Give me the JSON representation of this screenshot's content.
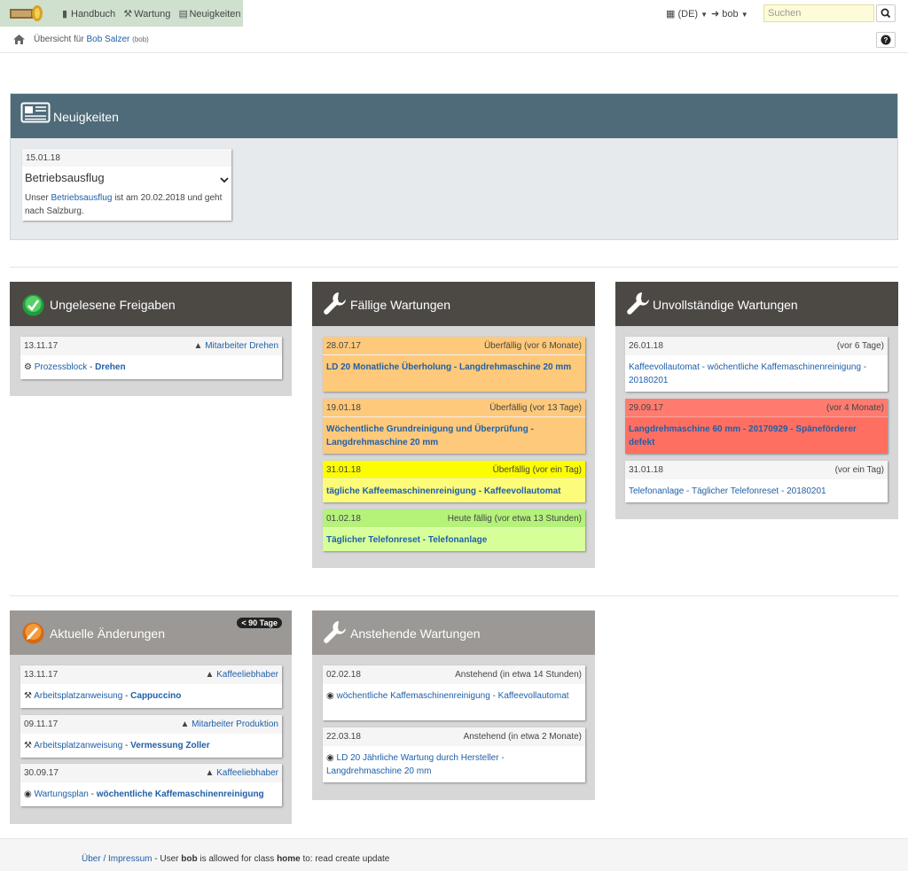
{
  "nav": {
    "handbuch": "Handbuch",
    "wartung": "Wartung",
    "neuigkeiten": "Neuigkeiten",
    "language": "(DE)",
    "user": "bob",
    "search_placeholder": "Suchen"
  },
  "breadcrumb": {
    "prefix": "Übersicht für",
    "user_name": "Bob Salzer",
    "user_login": "(bob)"
  },
  "news": {
    "title": "Neuigkeiten",
    "item": {
      "date": "15.01.18",
      "title": "Betriebsausflug",
      "text_before": "Unser",
      "link": "Betriebsausflug",
      "text_after": "ist am 20.02.2018 und geht nach Salzburg."
    }
  },
  "unread": {
    "title": "Ungelesene Freigaben",
    "items": [
      {
        "date": "13.11.17",
        "role": "Mitarbeiter Drehen",
        "type": "Prozessblock",
        "sep": " - ",
        "name": "Drehen"
      }
    ]
  },
  "due": {
    "title": "Fällige Wartungen",
    "items": [
      {
        "date": "28.07.17",
        "status": "Überfällig (vor 6 Monate)",
        "text": "LD 20 Monatliche Überholung - Langdrehmaschine 20 mm"
      },
      {
        "date": "19.01.18",
        "status": "Überfällig (vor 13 Tage)",
        "text": "Wöchentliche Grundreinigung und Überprüfung - Langdrehmaschine 20 mm"
      },
      {
        "date": "31.01.18",
        "status": "Überfällig (vor ein Tag)",
        "text": "tägliche Kaffeemaschinenreinigung - Kaffeevollautomat"
      },
      {
        "date": "01.02.18",
        "status": "Heute fällig (vor etwa 13 Stunden)",
        "text": "Täglicher Telefonreset - Telefonanlage"
      }
    ]
  },
  "incomplete": {
    "title": "Unvollständige Wartungen",
    "items": [
      {
        "date": "26.01.18",
        "status": "(vor 6 Tage)",
        "text": "Kaffeevollautomat - wöchentliche Kaffemaschinenreinigung - 20180201"
      },
      {
        "date": "29.09.17",
        "status": "(vor 4 Monate)",
        "text": "Langdrehmaschine 60 mm - 20170929 - Späneförderer defekt"
      },
      {
        "date": "31.01.18",
        "status": "(vor ein Tag)",
        "text": "Telefonanlage - Täglicher Telefonreset - 20180201"
      }
    ]
  },
  "changes": {
    "title": "Aktuelle Änderungen",
    "badge": "< 90 Tage",
    "items": [
      {
        "date": "13.11.17",
        "role": "Kaffeeliebhaber",
        "type": "Arbeitsplatzanweisung",
        "sep": " - ",
        "name": "Cappuccino"
      },
      {
        "date": "09.11.17",
        "role": "Mitarbeiter Produktion",
        "type": "Arbeitsplatzanweisung",
        "sep": " - ",
        "name": "Vermessung Zoller"
      },
      {
        "date": "30.09.17",
        "role": "Kaffeeliebhaber",
        "type": "Wartungsplan",
        "sep": " - ",
        "name": "wöchentliche Kaffemaschinenreinigung"
      }
    ]
  },
  "upcoming": {
    "title": "Anstehende Wartungen",
    "items": [
      {
        "date": "02.02.18",
        "status": "Anstehend (in etwa 14 Stunden)",
        "text": "wöchentliche Kaffemaschinenreinigung - Kaffeevollautomat"
      },
      {
        "date": "22.03.18",
        "status": "Anstehend (in etwa 2 Monate)",
        "text": "LD 20 Jährliche Wartung durch Hersteller - Langdrehmaschine 20 mm"
      }
    ]
  },
  "footer": {
    "link": "Über / Impressum",
    "text1": " - User ",
    "user": "bob",
    "text2": " is allowed for class ",
    "class": "home",
    "text3": " to: read create update"
  }
}
